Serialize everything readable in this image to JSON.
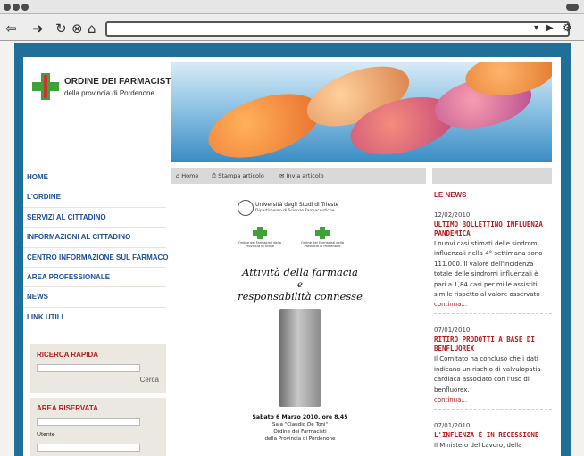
{
  "browser": {
    "back_icon": "back-arrow-icon",
    "forward_icon": "forward-arrow-icon",
    "reload_icon": "reload-icon",
    "stop_icon": "stop-icon",
    "home_icon": "home-icon",
    "url_value": ""
  },
  "site": {
    "logo_title": "ORDINE DEI FARMACISTI",
    "logo_subtitle": "della provincia di Pordenone",
    "accent": "#b31d1d",
    "link_color": "#1d4f9a",
    "banner_blue": "#1f6f98"
  },
  "nav": [
    {
      "label": "HOME"
    },
    {
      "label": "L'ORDINE"
    },
    {
      "label": "SERVIZI AL CITTADINO"
    },
    {
      "label": "INFORMAZIONI AL CITTADINO"
    },
    {
      "label": "CENTRO INFORMAZIONE SUL FARMACO"
    },
    {
      "label": "AREA PROFESSIONALE"
    },
    {
      "label": "NEWS"
    },
    {
      "label": "LINK UTILI"
    }
  ],
  "search": {
    "title": "RICERCA RAPIDA",
    "button": "Cerca",
    "value": ""
  },
  "reserved": {
    "title": "AREA RISERVATA",
    "user_label": "Utente"
  },
  "toolbar": {
    "home": "Home",
    "print": "Stampa articolo",
    "send": "Invia articolo"
  },
  "document": {
    "university": "Università degli Studi di Trieste",
    "department": "Dipartimento di Scienze Farmaceutiche",
    "order_left": "Ordine dei Farmacisti della Provincia di Udine",
    "order_right": "Ordine dei Farmacisti della Provincia di Pordenone",
    "title_line1": "Attività della farmacia",
    "title_line2": "e",
    "title_line3": "responsabilità connesse",
    "event_date": "Sabato 6 Marzo 2010, ore 8.45",
    "event_room": "Sala \"Claudio De Toni\"",
    "event_org": "Ordine dei Farmacisti",
    "event_org2": "della Provincia di Pordenone"
  },
  "news": {
    "heading": "LE NEWS",
    "items": [
      {
        "date": "12/02/2010",
        "title": "ULTIMO BOLLETTINO INFLUENZA PANDEMICA",
        "body": "I nuovi casi stimati delle sindromi influenzali nella 4° settimana sono 111.000. Il valore dell'incidenza totale delle sindromi influenzali è pari a 1,84 casi per mille assistiti, simile rispetto al valore osservato",
        "more": "continua..."
      },
      {
        "date": "07/01/2010",
        "title": "RITIRO PRODOTTI A BASE DI BENFLUOREX",
        "body": "Il Comitato ha concluso che i dati indicano un rischio di valvulopatia cardiaca associato con l'uso di benfluorex.",
        "more": "continua..."
      },
      {
        "date": "07/01/2010",
        "title": "L'INFLENZA È IN RECESSIONE",
        "body": "Il Ministero del Lavoro, della",
        "more": ""
      }
    ]
  }
}
